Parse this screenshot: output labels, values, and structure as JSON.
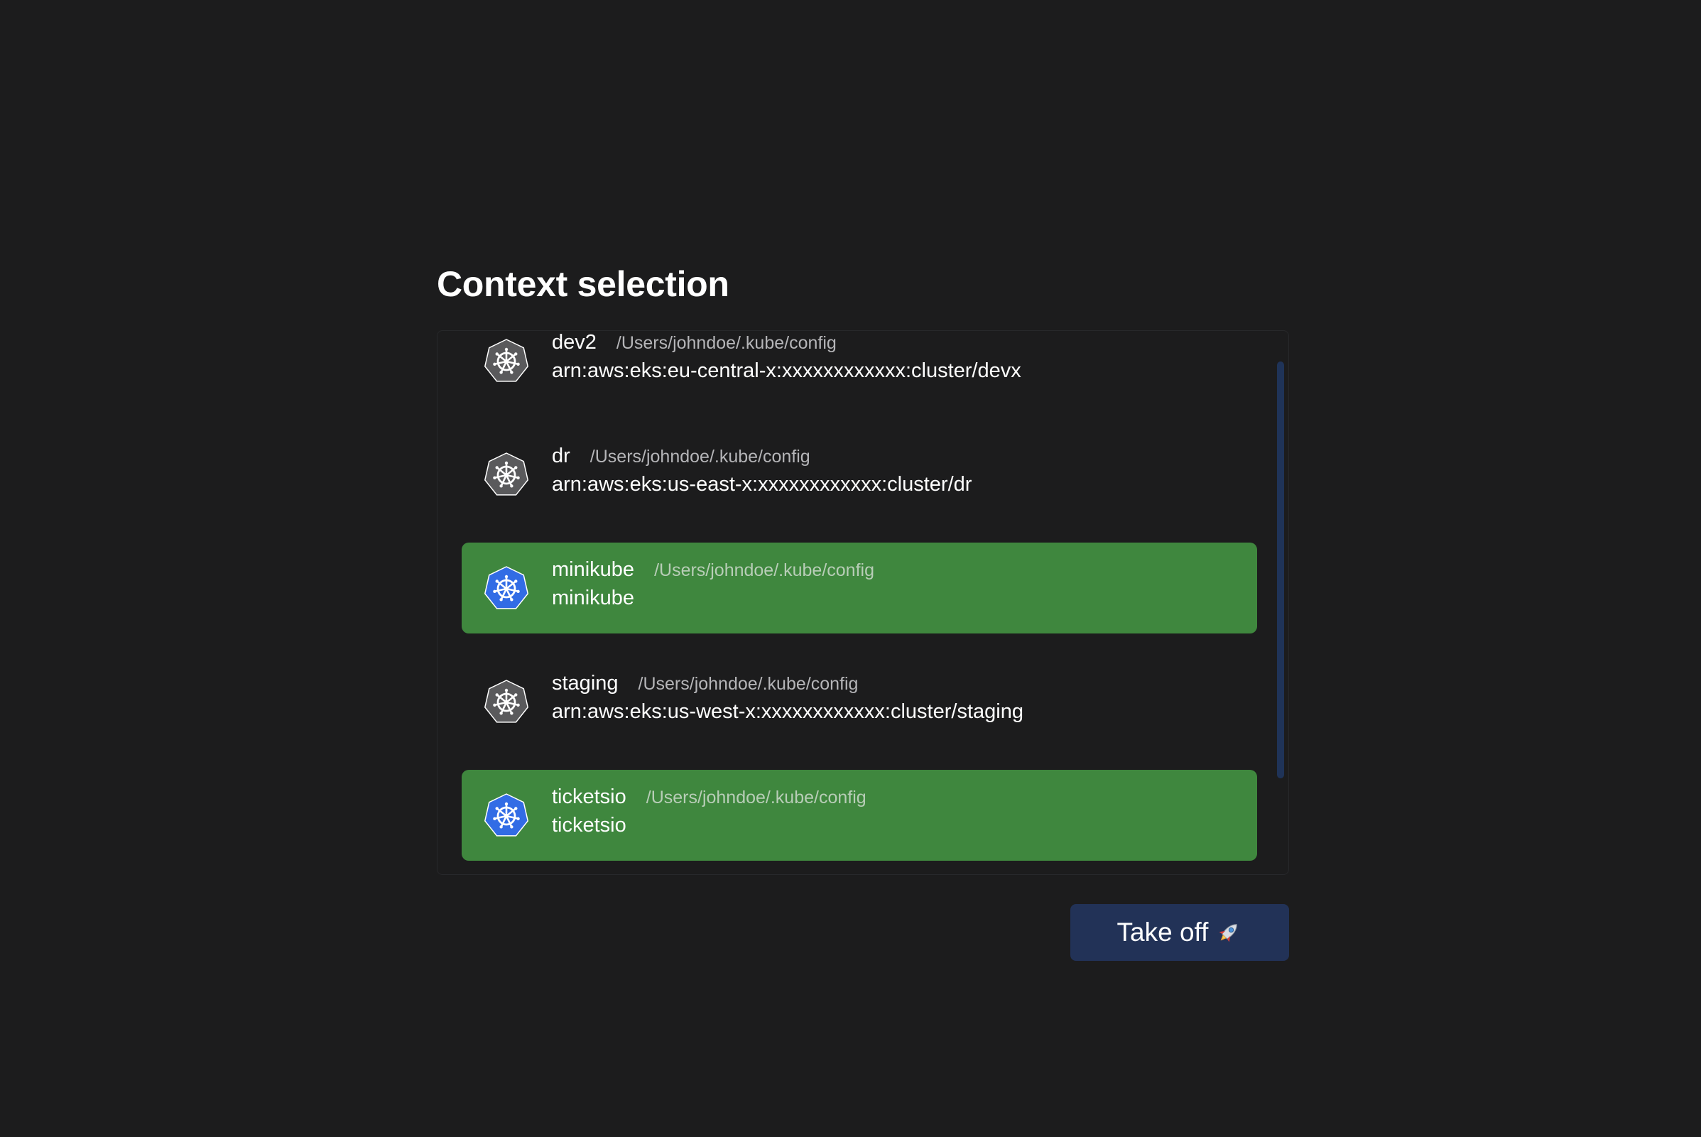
{
  "page_title": "Context selection",
  "contexts": [
    {
      "name": "dev2",
      "path": "/Users/johndoe/.kube/config",
      "cluster": "arn:aws:eks:eu-central-x:xxxxxxxxxxxx:cluster/devx",
      "selected": false,
      "icon": "kubernetes-icon"
    },
    {
      "name": "dr",
      "path": "/Users/johndoe/.kube/config",
      "cluster": "arn:aws:eks:us-east-x:xxxxxxxxxxxx:cluster/dr",
      "selected": false,
      "icon": "kubernetes-icon"
    },
    {
      "name": "minikube",
      "path": "/Users/johndoe/.kube/config",
      "cluster": "minikube",
      "selected": true,
      "icon": "kubernetes-icon"
    },
    {
      "name": "staging",
      "path": "/Users/johndoe/.kube/config",
      "cluster": "arn:aws:eks:us-west-x:xxxxxxxxxxxx:cluster/staging",
      "selected": false,
      "icon": "kubernetes-icon"
    },
    {
      "name": "ticketsio",
      "path": "/Users/johndoe/.kube/config",
      "cluster": "ticketsio",
      "selected": true,
      "icon": "kubernetes-icon"
    }
  ],
  "takeoff_button": {
    "label": "Take off",
    "icon": "rocket-icon"
  },
  "colors": {
    "background": "#1c1c1d",
    "selected_row": "#3f873e",
    "button": "#223257",
    "icon_active": "#326ce5",
    "icon_inactive": "#5a5a5c"
  }
}
